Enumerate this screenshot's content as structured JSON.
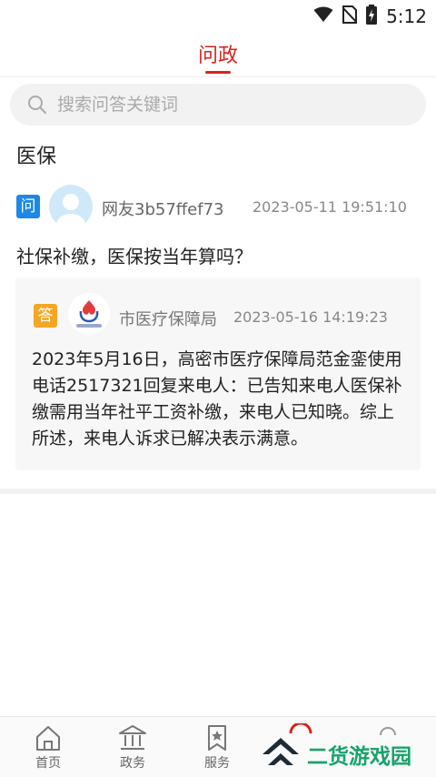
{
  "status_bar": {
    "time": "5:12",
    "icons": [
      "wifi-icon",
      "no-sim-icon",
      "battery-charging-icon"
    ]
  },
  "header": {
    "title": "问政",
    "accent_color": "#d9241c"
  },
  "search": {
    "placeholder": "搜索问答关键词",
    "value": ""
  },
  "section": {
    "title": "医保"
  },
  "question": {
    "badge": "问",
    "badge_color": "#1e88e5",
    "user": "网友3b57ffef73",
    "time": "2023-05-11 19:51:10",
    "text": "社保补缴，医保按当年算吗？"
  },
  "answer": {
    "badge": "答",
    "badge_color": "#f5a623",
    "org": "市医疗保障局",
    "time": "2023-05-16 14:19:23",
    "text": "2023年5月16日，高密市医疗保障局范金銮使用电话2517321回复来电人：已告知来电人医保补缴需用当年社平工资补缴，来电人已知晓。综上所述，来电人诉求已解决表示满意。"
  },
  "tab_bar": {
    "items": [
      {
        "label": "首页",
        "icon": "home-icon"
      },
      {
        "label": "政务",
        "icon": "government-building-icon"
      },
      {
        "label": "服务",
        "icon": "bookmark-star-icon"
      }
    ]
  },
  "watermark": {
    "text": "二货游戏园",
    "color": "#18a36b"
  }
}
